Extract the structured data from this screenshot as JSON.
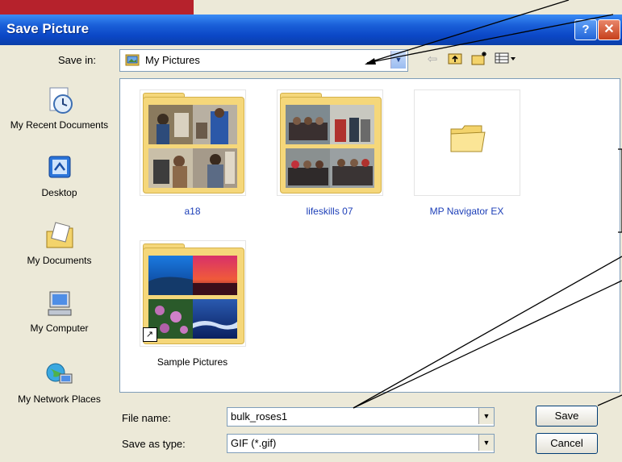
{
  "window": {
    "title": "Save Picture",
    "help_glyph": "?",
    "close_glyph": "✕"
  },
  "top_bar": {
    "save_in_label": "Save in:",
    "save_in_value": "My Pictures",
    "toolbar_icons": [
      "back-arrow-icon",
      "up-folder-icon",
      "new-folder-icon",
      "view-menu-icon"
    ],
    "back_glyph": "⇦",
    "up_glyph": "⮤",
    "new_folder_glyph": "✳",
    "view_glyph": "▦▾"
  },
  "places": [
    {
      "label": "My Recent Documents",
      "icon": "recent-documents-icon"
    },
    {
      "label": "Desktop",
      "icon": "desktop-icon"
    },
    {
      "label": "My Documents",
      "icon": "my-documents-icon"
    },
    {
      "label": "My Computer",
      "icon": "my-computer-icon"
    },
    {
      "label": "My Network Places",
      "icon": "network-places-icon"
    }
  ],
  "files": [
    {
      "label": "a18",
      "type": "folder-with-photos"
    },
    {
      "label": "lifeskills 07",
      "type": "folder-with-photos"
    },
    {
      "label": "MP Navigator EX",
      "type": "empty-folder"
    },
    {
      "label": "Sample Pictures",
      "type": "folder-shortcut-with-photos"
    }
  ],
  "bottom": {
    "file_name_label": "File name:",
    "file_name_value": "bulk_roses1",
    "file_type_label": "Save as type:",
    "file_type_value": "GIF (*.gif)",
    "save_button": "Save",
    "cancel_button": "Cancel"
  },
  "colors": {
    "title_bar": "#0b47c6",
    "selected_label": "#1d3fb8",
    "folder": "#f5d77a"
  }
}
